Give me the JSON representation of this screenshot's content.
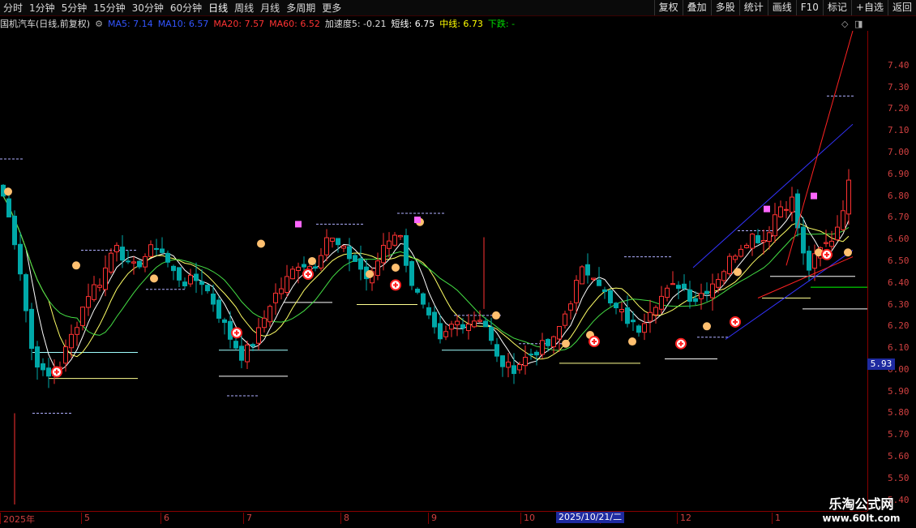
{
  "toolbar": {
    "periods": [
      "分时",
      "1分钟",
      "5分钟",
      "15分钟",
      "30分钟",
      "60分钟",
      "日线",
      "周线",
      "月线",
      "多周期",
      "更多"
    ],
    "active_period": "日线",
    "right_buttons": [
      "复权",
      "叠加",
      "多股",
      "统计",
      "画线",
      "F10",
      "标记",
      "+自选",
      "返回"
    ]
  },
  "info": {
    "stock": "国机汽车(日线,前复权)",
    "ma5": "MA5: 7.14",
    "ma10": "MA10: 6.57",
    "ma20": "MA20: 7.57",
    "ma60": "MA60: 6.52",
    "accel": "加速度5: -0.21",
    "short": "短线: 6.75",
    "mid": "中线: 6.73",
    "trend": "下跌: -",
    "colors": {
      "ma5": "#3355ff",
      "ma10": "#3355ff",
      "ma20": "#ff3333",
      "ma60": "#ff3333",
      "accel": "#dddddd",
      "short": "#ffffff",
      "mid": "#ffff00",
      "trend": "#00dd00"
    }
  },
  "current_price": "5.93",
  "crosshair_date": "2025/10/21/二",
  "watermark": {
    "line1": "乐淘公式网",
    "line2": "www.60lt.com"
  },
  "chart_data": {
    "type": "candlestick",
    "y_ticks": [
      "7.40",
      "7.30",
      "7.20",
      "7.10",
      "7.00",
      "6.90",
      "6.80",
      "6.70",
      "6.60",
      "6.50",
      "6.40",
      "6.30",
      "6.20",
      "6.10",
      "6.00",
      "5.90",
      "5.80",
      "5.70",
      "5.60",
      "5.50",
      "5.40"
    ],
    "ylim": [
      5.35,
      7.56
    ],
    "x_ticks": [
      "2025年",
      "5",
      "6",
      "7",
      "8",
      "9",
      "10",
      "11",
      "12",
      "1"
    ],
    "up_color": "#ff3232",
    "down_color": "#00a8a8",
    "close_path": [
      6.8,
      6.55,
      6.1,
      5.95,
      6.02,
      6.18,
      6.35,
      6.42,
      6.6,
      6.45,
      6.52,
      6.58,
      6.45,
      6.4,
      6.42,
      6.3,
      6.16,
      6.06,
      6.15,
      6.32,
      6.4,
      6.5,
      6.47,
      6.62,
      6.55,
      6.5,
      6.4,
      6.58,
      6.65,
      6.4,
      6.25,
      6.12,
      6.22,
      6.22,
      6.25,
      6.05,
      6.0,
      6.05,
      6.1,
      6.12,
      6.28,
      6.45,
      6.45,
      6.3,
      6.25,
      6.18,
      6.3,
      6.35,
      6.4,
      6.32,
      6.38,
      6.45,
      6.55,
      6.62,
      6.6,
      6.75,
      6.78,
      6.45,
      6.55,
      6.62,
      6.85
    ],
    "up_marks": [
      [
        0,
        6.82
      ],
      [
        84,
        6.48
      ],
      [
        180,
        6.42
      ],
      [
        312,
        6.58
      ],
      [
        375,
        6.5
      ],
      [
        446,
        6.44
      ],
      [
        478,
        6.47
      ],
      [
        508,
        6.68
      ],
      [
        602,
        6.25
      ],
      [
        688,
        6.12
      ],
      [
        718,
        6.16
      ],
      [
        770,
        6.13
      ],
      [
        862,
        6.2
      ],
      [
        900,
        6.45
      ],
      [
        1000,
        6.54
      ],
      [
        1036,
        6.54
      ]
    ],
    "circle_marks": [
      [
        70,
        5.99
      ],
      [
        292,
        6.17
      ],
      [
        380,
        6.44
      ],
      [
        488,
        6.39
      ],
      [
        733,
        6.13
      ],
      [
        840,
        6.12
      ],
      [
        907,
        6.22
      ],
      [
        1020,
        6.53
      ]
    ],
    "pink_marks": [
      [
        368,
        6.67
      ],
      [
        515,
        6.69
      ],
      [
        946,
        6.74
      ],
      [
        1004,
        6.8
      ]
    ]
  }
}
